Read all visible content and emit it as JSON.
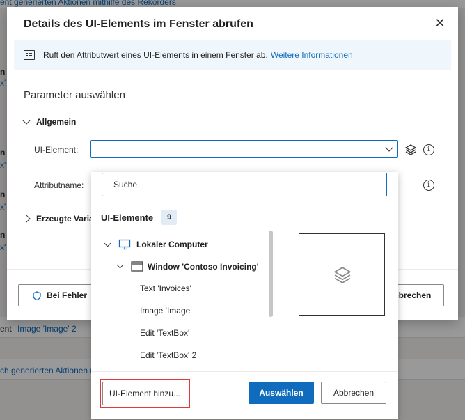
{
  "background": {
    "fragments": [
      {
        "text": "ent generierten Aktionen mithilfe des Rekorders",
        "kind": "link"
      },
      {
        "text": "x'",
        "kind": "link"
      },
      {
        "text": "x'",
        "kind": "link"
      },
      {
        "text": "x'",
        "kind": "link"
      },
      {
        "text": "x'",
        "kind": "link"
      },
      {
        "text": "ent",
        "kind": "plain"
      },
      {
        "text": "Image 'Image' 2",
        "kind": "link"
      },
      {
        "text": "ch generierten Aktionen m",
        "kind": "link"
      }
    ]
  },
  "dialog": {
    "title": "Details des UI-Elements im Fenster abrufen",
    "close_glyph": "✕",
    "info_text": "Ruft den Attributwert eines UI-Elements in einem Fenster ab.",
    "info_link": "Weitere Informationen",
    "section_title": "Parameter auswählen",
    "group_general": "Allgemein",
    "ui_element_label": "UI-Element:",
    "ui_element_value": "",
    "attribute_label": "Attributname:",
    "group_vars": "Erzeugte Variablen",
    "on_error_button": "Bei Fehler",
    "cancel_button": "Abbrechen"
  },
  "picker": {
    "search_placeholder": "Suche",
    "heading": "UI-Elemente",
    "count": "9",
    "tree": [
      {
        "label": "Lokaler Computer",
        "level": 0,
        "icon": "monitor-icon",
        "expanded": true,
        "bold": true
      },
      {
        "label": "Window 'Contoso Invoicing'",
        "level": 1,
        "icon": "window-icon",
        "expanded": true,
        "bold": true
      },
      {
        "label": "Text 'Invoices'",
        "level": 2,
        "bold": false
      },
      {
        "label": "Image 'Image'",
        "level": 2,
        "bold": false
      },
      {
        "label": "Edit 'TextBox'",
        "level": 2,
        "bold": false
      },
      {
        "label": "Edit 'TextBox' 2",
        "level": 2,
        "bold": false
      }
    ],
    "add_button": "UI-Element hinzu...",
    "select_button": "Auswählen",
    "cancel_button": "Abbrechen"
  },
  "colors": {
    "accent": "#0f6cbd",
    "highlight": "#e03b3b",
    "info_bg": "#eff6fc"
  }
}
